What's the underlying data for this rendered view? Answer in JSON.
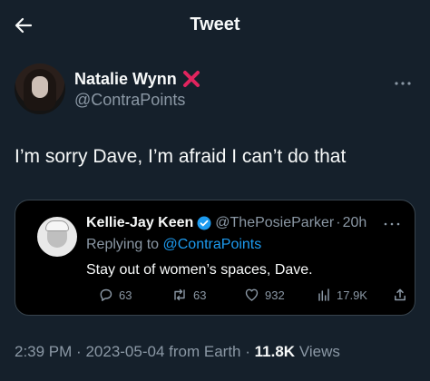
{
  "header": {
    "title": "Tweet",
    "back_icon": "arrow-left-icon"
  },
  "tweet": {
    "author": {
      "display_name": "Natalie Wynn",
      "name_badge": "❌",
      "handle": "@ContraPoints"
    },
    "text": "I’m sorry Dave, I’m afraid I can’t do that",
    "quoted": {
      "author_name": "Kellie-Jay Keen",
      "verified_icon": "verified-badge-icon",
      "handle": "@ThePosieParker",
      "separator": "·",
      "time": "20h",
      "replying_prefix": "Replying to",
      "replying_mention": "@ContraPoints",
      "text": "Stay out of women’s spaces, Dave.",
      "actions": {
        "replies": "63",
        "retweets": "63",
        "likes": "932",
        "views": "17.9K"
      }
    },
    "meta": {
      "time": "2:39 PM",
      "sep1": "·",
      "date": "2023-05-04",
      "source": "from Earth",
      "sep2": "·",
      "views_count": "11.8K",
      "views_label": "Views"
    }
  },
  "colors": {
    "background": "#15202b",
    "text": "#f7f9f9",
    "secondary": "#8b98a5",
    "accent": "#1d9bf0",
    "badge_red": "#e0245e"
  }
}
